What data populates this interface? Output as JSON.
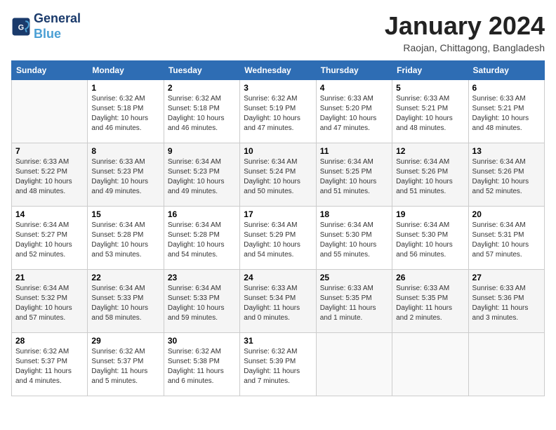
{
  "logo": {
    "line1": "General",
    "line2": "Blue"
  },
  "title": "January 2024",
  "subtitle": "Raojan, Chittagong, Bangladesh",
  "days_of_week": [
    "Sunday",
    "Monday",
    "Tuesday",
    "Wednesday",
    "Thursday",
    "Friday",
    "Saturday"
  ],
  "weeks": [
    [
      {
        "day": "",
        "info": ""
      },
      {
        "day": "1",
        "info": "Sunrise: 6:32 AM\nSunset: 5:18 PM\nDaylight: 10 hours\nand 46 minutes."
      },
      {
        "day": "2",
        "info": "Sunrise: 6:32 AM\nSunset: 5:18 PM\nDaylight: 10 hours\nand 46 minutes."
      },
      {
        "day": "3",
        "info": "Sunrise: 6:32 AM\nSunset: 5:19 PM\nDaylight: 10 hours\nand 47 minutes."
      },
      {
        "day": "4",
        "info": "Sunrise: 6:33 AM\nSunset: 5:20 PM\nDaylight: 10 hours\nand 47 minutes."
      },
      {
        "day": "5",
        "info": "Sunrise: 6:33 AM\nSunset: 5:21 PM\nDaylight: 10 hours\nand 48 minutes."
      },
      {
        "day": "6",
        "info": "Sunrise: 6:33 AM\nSunset: 5:21 PM\nDaylight: 10 hours\nand 48 minutes."
      }
    ],
    [
      {
        "day": "7",
        "info": ""
      },
      {
        "day": "8",
        "info": "Sunrise: 6:33 AM\nSunset: 5:23 PM\nDaylight: 10 hours\nand 49 minutes."
      },
      {
        "day": "9",
        "info": "Sunrise: 6:34 AM\nSunset: 5:23 PM\nDaylight: 10 hours\nand 49 minutes."
      },
      {
        "day": "10",
        "info": "Sunrise: 6:34 AM\nSunset: 5:24 PM\nDaylight: 10 hours\nand 50 minutes."
      },
      {
        "day": "11",
        "info": "Sunrise: 6:34 AM\nSunset: 5:25 PM\nDaylight: 10 hours\nand 51 minutes."
      },
      {
        "day": "12",
        "info": "Sunrise: 6:34 AM\nSunset: 5:26 PM\nDaylight: 10 hours\nand 51 minutes."
      },
      {
        "day": "13",
        "info": "Sunrise: 6:34 AM\nSunset: 5:26 PM\nDaylight: 10 hours\nand 52 minutes."
      }
    ],
    [
      {
        "day": "14",
        "info": ""
      },
      {
        "day": "15",
        "info": "Sunrise: 6:34 AM\nSunset: 5:28 PM\nDaylight: 10 hours\nand 53 minutes."
      },
      {
        "day": "16",
        "info": "Sunrise: 6:34 AM\nSunset: 5:28 PM\nDaylight: 10 hours\nand 54 minutes."
      },
      {
        "day": "17",
        "info": "Sunrise: 6:34 AM\nSunset: 5:29 PM\nDaylight: 10 hours\nand 54 minutes."
      },
      {
        "day": "18",
        "info": "Sunrise: 6:34 AM\nSunset: 5:30 PM\nDaylight: 10 hours\nand 55 minutes."
      },
      {
        "day": "19",
        "info": "Sunrise: 6:34 AM\nSunset: 5:30 PM\nDaylight: 10 hours\nand 56 minutes."
      },
      {
        "day": "20",
        "info": "Sunrise: 6:34 AM\nSunset: 5:31 PM\nDaylight: 10 hours\nand 57 minutes."
      }
    ],
    [
      {
        "day": "21",
        "info": ""
      },
      {
        "day": "22",
        "info": "Sunrise: 6:34 AM\nSunset: 5:33 PM\nDaylight: 10 hours\nand 58 minutes."
      },
      {
        "day": "23",
        "info": "Sunrise: 6:34 AM\nSunset: 5:33 PM\nDaylight: 10 hours\nand 59 minutes."
      },
      {
        "day": "24",
        "info": "Sunrise: 6:33 AM\nSunset: 5:34 PM\nDaylight: 11 hours\nand 0 minutes."
      },
      {
        "day": "25",
        "info": "Sunrise: 6:33 AM\nSunset: 5:35 PM\nDaylight: 11 hours\nand 1 minute."
      },
      {
        "day": "26",
        "info": "Sunrise: 6:33 AM\nSunset: 5:35 PM\nDaylight: 11 hours\nand 2 minutes."
      },
      {
        "day": "27",
        "info": "Sunrise: 6:33 AM\nSunset: 5:36 PM\nDaylight: 11 hours\nand 3 minutes."
      }
    ],
    [
      {
        "day": "28",
        "info": ""
      },
      {
        "day": "29",
        "info": "Sunrise: 6:32 AM\nSunset: 5:37 PM\nDaylight: 11 hours\nand 5 minutes."
      },
      {
        "day": "30",
        "info": "Sunrise: 6:32 AM\nSunset: 5:38 PM\nDaylight: 11 hours\nand 6 minutes."
      },
      {
        "day": "31",
        "info": "Sunrise: 6:32 AM\nSunset: 5:39 PM\nDaylight: 11 hours\nand 7 minutes."
      },
      {
        "day": "",
        "info": ""
      },
      {
        "day": "",
        "info": ""
      },
      {
        "day": "",
        "info": ""
      }
    ]
  ],
  "week1_day7_info": "Sunrise: 6:33 AM\nSunset: 5:22 PM\nDaylight: 10 hours\nand 48 minutes.",
  "week2_day1_info": "Sunrise: 6:33 AM\nSunset: 5:22 PM\nDaylight: 10 hours\nand 48 minutes.",
  "week3_day1_info": "Sunrise: 6:34 AM\nSunset: 5:27 PM\nDaylight: 10 hours\nand 52 minutes.",
  "week4_day1_info": "Sunrise: 6:34 AM\nSunset: 5:32 PM\nDaylight: 10 hours\nand 57 minutes.",
  "week5_day1_info": "Sunrise: 6:32 AM\nSunset: 5:37 PM\nDaylight: 11 hours\nand 4 minutes."
}
